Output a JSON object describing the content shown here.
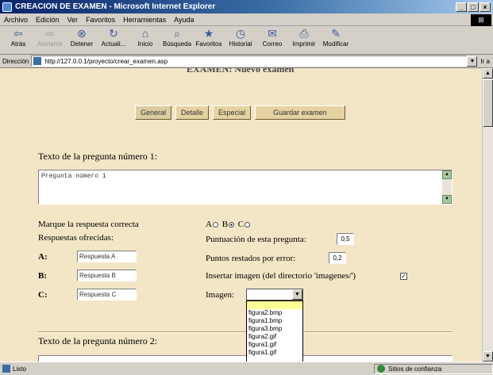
{
  "window": {
    "title": "CREACIÓN DE EXAMEN - Microsoft Internet Explorer",
    "buttons": [
      "_",
      "□",
      "×"
    ]
  },
  "menu": [
    "Archivo",
    "Edición",
    "Ver",
    "Favoritos",
    "Herramientas",
    "Ayuda"
  ],
  "toolbar": {
    "items": [
      {
        "label": "Atrás",
        "icon": "back-arrow-icon",
        "glyph": "⇦",
        "disabled": false
      },
      {
        "label": "Adelante",
        "icon": "forward-arrow-icon",
        "glyph": "⇨",
        "disabled": true
      },
      {
        "label": "Detener",
        "icon": "stop-icon",
        "glyph": "⊗",
        "disabled": false
      },
      {
        "label": "Actuali...",
        "icon": "refresh-icon",
        "glyph": "↻",
        "disabled": false
      },
      {
        "label": "Inicio",
        "icon": "home-icon",
        "glyph": "⌂",
        "disabled": false
      },
      {
        "label": "Búsqueda",
        "icon": "search-icon",
        "glyph": "⌕",
        "disabled": false
      },
      {
        "label": "Favoritos",
        "icon": "favorites-icon",
        "glyph": "★",
        "disabled": false
      },
      {
        "label": "Historial",
        "icon": "history-icon",
        "glyph": "◷",
        "disabled": false
      },
      {
        "label": "Correo",
        "icon": "mail-icon",
        "glyph": "✉",
        "disabled": false
      },
      {
        "label": "Imprimir",
        "icon": "print-icon",
        "glyph": "⎙",
        "disabled": false
      },
      {
        "label": "Modificar",
        "icon": "edit-icon",
        "glyph": "✎",
        "disabled": false
      }
    ]
  },
  "address": {
    "label": "Dirección",
    "url": "http://127.0.0.1/proyecto/crear_examen.asp",
    "go": "Ir a"
  },
  "page": {
    "heading": "EXAMEN: Nuevo examen",
    "nav_buttons": [
      "General",
      "Detalle",
      "Especial",
      "Guardar examen"
    ],
    "q1": {
      "title": "Texto de la pregunta número 1:",
      "text": "Pregunta número 1",
      "correct_label": "Marque la respuesta correcta",
      "options": [
        {
          "letter": "A",
          "selected": false
        },
        {
          "letter": "B",
          "selected": true
        },
        {
          "letter": "C",
          "selected": false
        }
      ],
      "answers_label": "Respuestas ofrecidas:",
      "answers": [
        {
          "key": "A:",
          "value": "Respuesta A"
        },
        {
          "key": "B:",
          "value": "Respuesta B"
        },
        {
          "key": "C:",
          "value": "Respuesta C"
        }
      ],
      "score_label": "Puntuación de esta pregunta:",
      "score": "0,5",
      "penalty_label": "Puntos restados por error:",
      "penalty": "0,2",
      "insert_image_label": "Insertar imagen (del directorio 'imagenes/')",
      "insert_image_checked": true,
      "image_label": "Imagen:",
      "image_options": [
        "",
        "figura2.bmp",
        "figura1.bmp",
        "figura3.bmp",
        "figura2.gif",
        "figura1.gif",
        "figura1.gif"
      ]
    },
    "q2": {
      "title": "Texto de la pregunta número 2:"
    }
  },
  "status": {
    "text": "Listo",
    "zone": "Sitios de confianza"
  }
}
